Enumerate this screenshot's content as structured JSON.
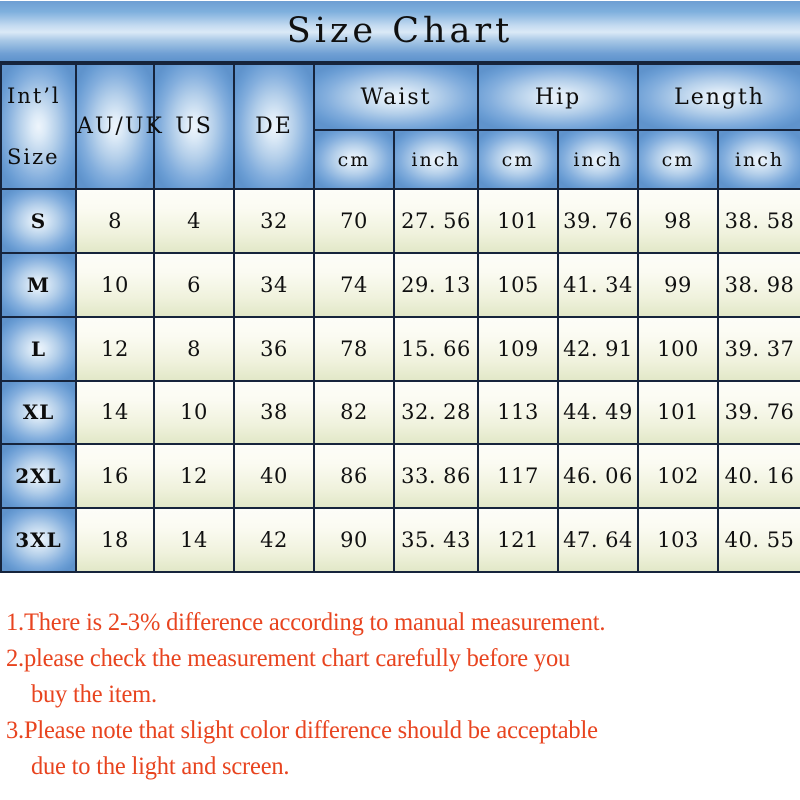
{
  "title": "Size Chart",
  "table": {
    "header": {
      "intl_line1": "Int’l",
      "intl_line2": "Size",
      "col_au_uk": "AU/UK",
      "col_us": "US",
      "col_de": "DE",
      "group_waist": "Waist",
      "group_hip": "Hip",
      "group_length": "Length",
      "unit_cm_waist": "cm",
      "unit_inch_waist": "inch",
      "unit_cm_hip": "cm",
      "unit_inch_hip": "inch",
      "unit_cm_length": "cm",
      "unit_inch_length": "inch"
    },
    "rows": [
      {
        "size": "S",
        "au_uk": "8",
        "us": "4",
        "de": "32",
        "waist_cm": "70",
        "waist_inch": "27. 56",
        "hip_cm": "101",
        "hip_inch": "39. 76",
        "length_cm": "98",
        "length_inch": "38. 58"
      },
      {
        "size": "M",
        "au_uk": "10",
        "us": "6",
        "de": "34",
        "waist_cm": "74",
        "waist_inch": "29. 13",
        "hip_cm": "105",
        "hip_inch": "41. 34",
        "length_cm": "99",
        "length_inch": "38. 98"
      },
      {
        "size": "L",
        "au_uk": "12",
        "us": "8",
        "de": "36",
        "waist_cm": "78",
        "waist_inch": "15. 66",
        "hip_cm": "109",
        "hip_inch": "42. 91",
        "length_cm": "100",
        "length_inch": "39. 37"
      },
      {
        "size": "XL",
        "au_uk": "14",
        "us": "10",
        "de": "38",
        "waist_cm": "82",
        "waist_inch": "32. 28",
        "hip_cm": "113",
        "hip_inch": "44. 49",
        "length_cm": "101",
        "length_inch": "39. 76"
      },
      {
        "size": "2XL",
        "au_uk": "16",
        "us": "12",
        "de": "40",
        "waist_cm": "86",
        "waist_inch": "33. 86",
        "hip_cm": "117",
        "hip_inch": "46. 06",
        "length_cm": "102",
        "length_inch": "40. 16"
      },
      {
        "size": "3XL",
        "au_uk": "18",
        "us": "14",
        "de": "42",
        "waist_cm": "90",
        "waist_inch": "35. 43",
        "hip_cm": "121",
        "hip_inch": "47. 64",
        "length_cm": "103",
        "length_inch": "40. 55"
      }
    ]
  },
  "notes": {
    "line1": "1.There is 2-3% difference according to manual measurement.",
    "line2": "2.please check the measurement chart carefully before you",
    "line3": "buy the item.",
    "line4": "3.Please note that slight color difference should be acceptable",
    "line5": "due to the light and screen."
  },
  "colors": {
    "header_blue": "#5f93cc",
    "header_highlight": "#eef5fc",
    "cell_top": "#fdfdf8",
    "cell_bottom": "#e2e8c8",
    "border": "#16243c",
    "note_red": "#e8441f",
    "title_text": "#101010"
  }
}
